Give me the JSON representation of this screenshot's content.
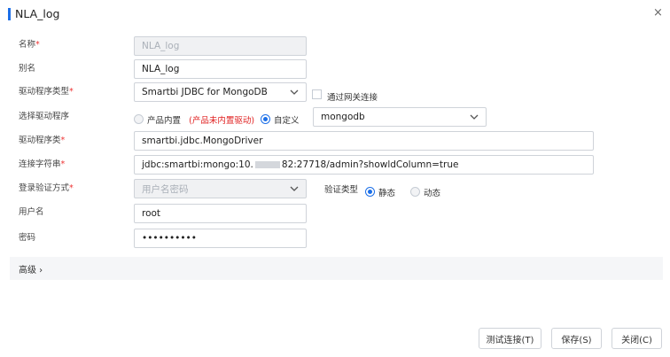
{
  "dialog": {
    "title": "NLA_log",
    "close_glyph": "×"
  },
  "fields": {
    "name_label": "名称",
    "name_value": "NLA_log",
    "alias_label": "别名",
    "alias_value": "NLA_log",
    "driver_type_label": "驱动程序类型",
    "driver_type_value": "Smartbi JDBC for MongoDB",
    "gateway_label": "通过网关连接",
    "select_driver_label": "选择驱动程序",
    "builtin_label": "产品内置",
    "builtin_note": "(产品未内置驱动)",
    "custom_label": "自定义",
    "custom_driver_value": "mongodb",
    "driver_class_label": "驱动程序类",
    "driver_class_value": "smartbi.jdbc.MongoDriver",
    "conn_str_label": "连接字符串",
    "conn_str_prefix": "jdbc:smartbi:mongo:10.",
    "conn_str_suffix": "82:27718/admin?showldColumn=true",
    "auth_label": "登录验证方式",
    "auth_placeholder": "用户名密码",
    "verify_type_label": "验证类型",
    "static_label": "静态",
    "dynamic_label": "动态",
    "username_label": "用户名",
    "username_value": "root",
    "password_label": "密码",
    "password_value": "••••••••••",
    "required_mark": "*"
  },
  "advanced": {
    "label": "高级 ›"
  },
  "buttons": {
    "test": "测试连接(T)",
    "save": "保存(S)",
    "close": "关闭(C)"
  },
  "colors": {
    "accent": "#1c6fe8",
    "required": "#e33333",
    "warning": "#e02020"
  }
}
